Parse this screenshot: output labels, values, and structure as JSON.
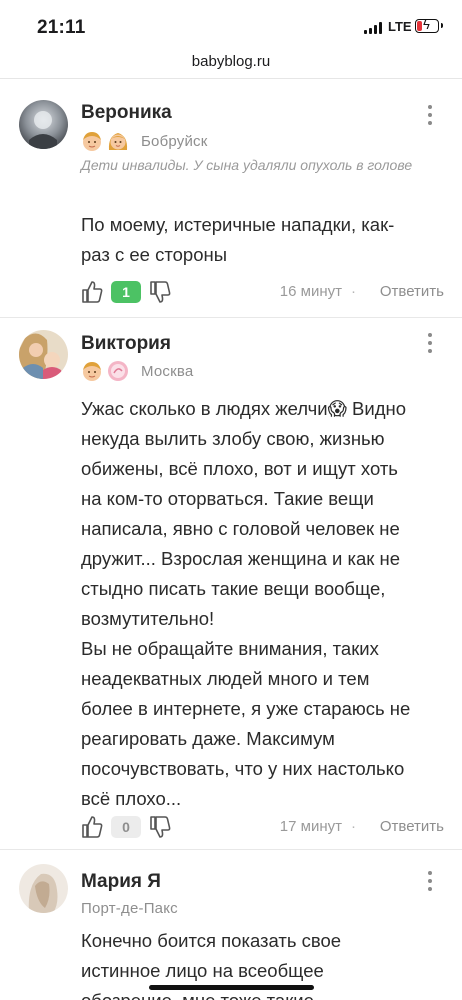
{
  "status_bar": {
    "time": "21:11",
    "network": "LTE",
    "battery_charging": true,
    "colors": {
      "battery_low": "#e5343a"
    }
  },
  "browser": {
    "url": "babyblog.ru"
  },
  "comments": [
    {
      "author": "Вероника",
      "kids_icons": [
        "boy-icon",
        "girl-icon"
      ],
      "city": "Бобруйск",
      "status": "Дети инвалиды. У сына удаляли опухоль в голове",
      "text": "По моему, истеричные нападки, как-\nраз с ее стороны",
      "votes": "1",
      "time_ago": "16 минут",
      "separator": "·",
      "reply_label": "Ответить"
    },
    {
      "author": "Виктория",
      "kids_icons": [
        "boy-icon",
        "baby-pink-icon"
      ],
      "city": "Москва",
      "text": "Ужас сколько в людях желчи😱 Видно\nнекуда вылить злобу свою, жизнью\nобижены, всё плохо, вот и ищут хоть\nна ком-то оторваться. Такие вещи\nнаписала, явно с головой человек не\nдружит... Взрослая женщина и как не\nстыдно писать такие вещи вообще,\nвозмутительно!\nВы не обращайте внимания, таких\nнеадекватных людей много и тем\nболее в интернете, я уже стараюсь не\nреагировать даже. Максимум\nпосочувствовать, что у них настолько\nвсё плохо...",
      "votes": "0",
      "time_ago": "17 минут",
      "separator": "·",
      "reply_label": "Ответить"
    },
    {
      "author": "Мария Я",
      "city": "Порт-де-Пакс",
      "text": "Конечно боится показать свое\nистинное лицо на всеобщее\nобозрение, мне тоже такие"
    }
  ],
  "colors": {
    "vote_positive": "#4cc264",
    "vote_zero": "#ececec",
    "muted_text": "#9a9a9a"
  }
}
